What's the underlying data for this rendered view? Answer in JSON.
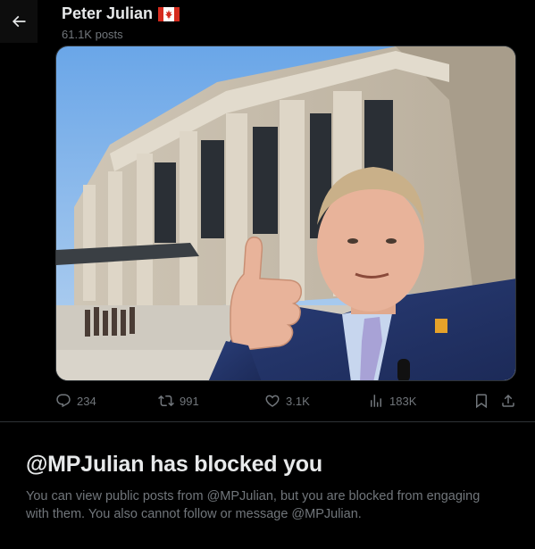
{
  "header": {
    "back_icon": "arrow-left-icon",
    "name": "Peter Julian",
    "flag_icon": "canada-flag-icon",
    "posts_count": "61.1K posts"
  },
  "post": {
    "image_description_icon": "photo",
    "actions": {
      "replies": "234",
      "reposts": "991",
      "likes": "3.1K",
      "views": "183K"
    }
  },
  "blocked": {
    "title": "@MPJulian has blocked you",
    "text": "You can view public posts from @MPJulian, but you are blocked from engaging with them. You also cannot follow or message @MPJulian."
  },
  "colors": {
    "background": "#000000",
    "primary_text": "#e7e9ea",
    "secondary_text": "#71767b",
    "border": "#2f3336"
  }
}
